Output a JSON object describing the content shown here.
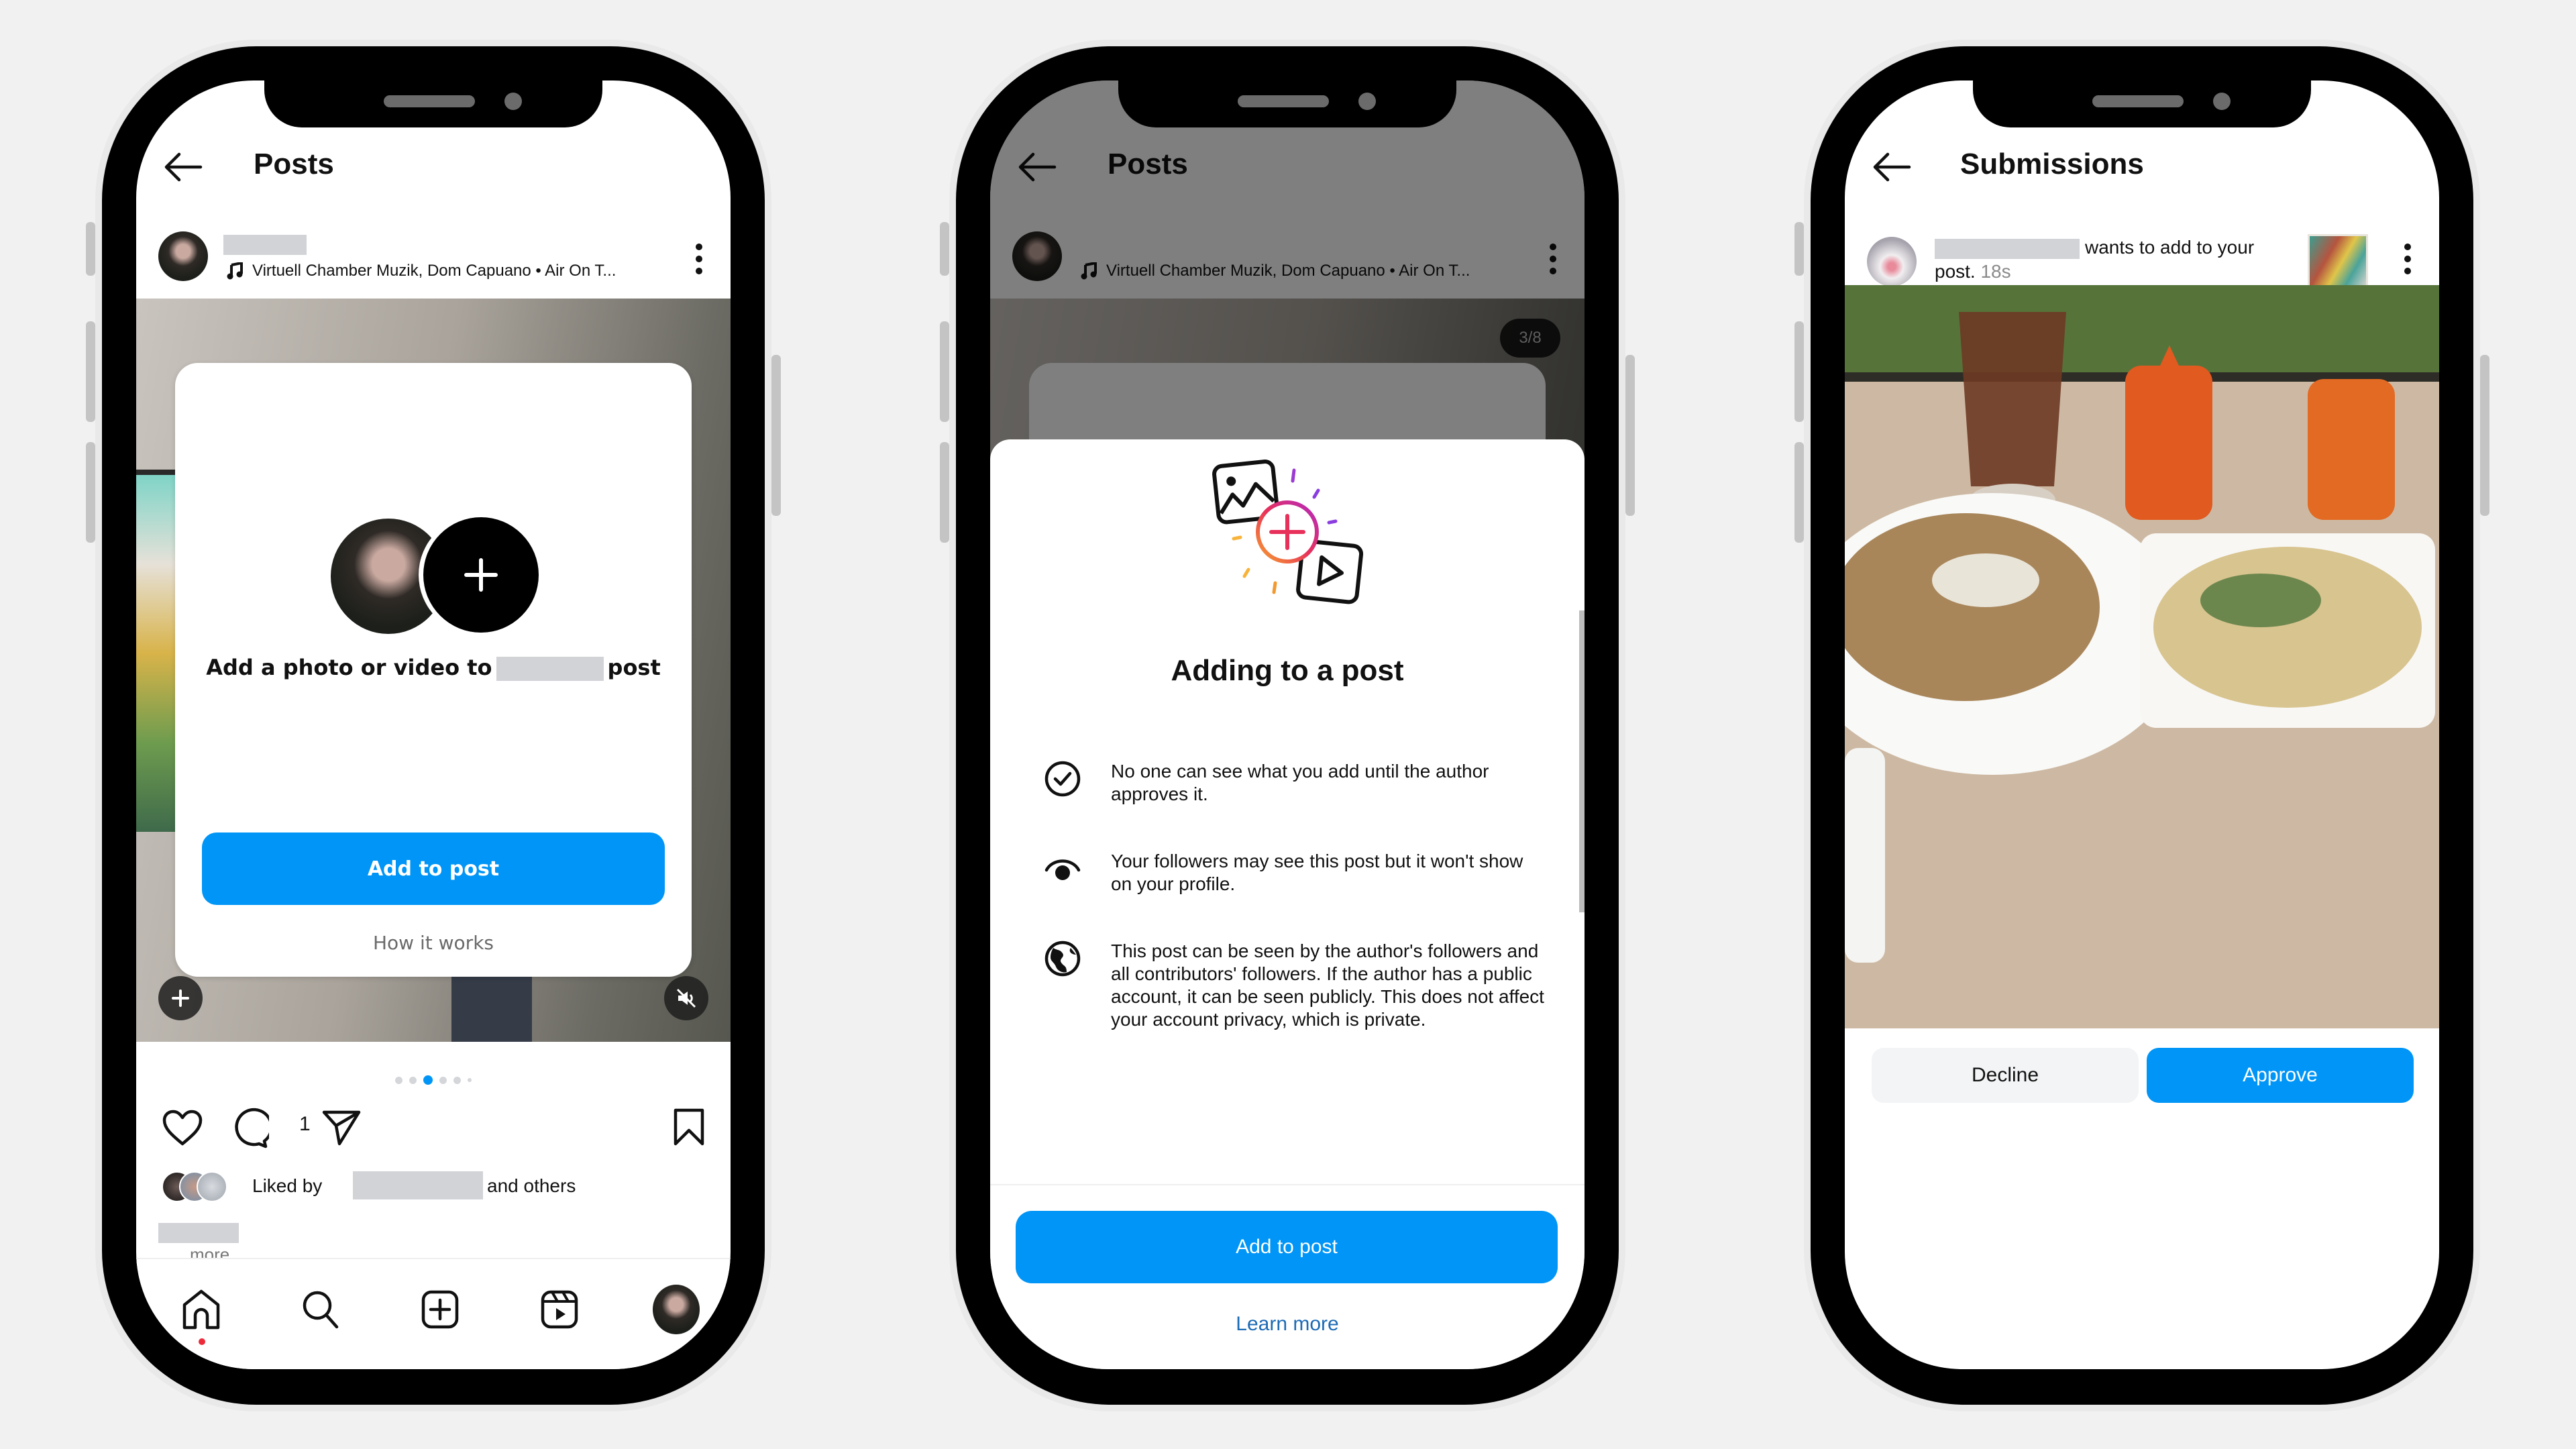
{
  "colors": {
    "primary_blue": "#0095f6",
    "link_blue": "#1c6bb5",
    "redaction_gray": "#d2d3d7",
    "notification_red": "#ed2a3a",
    "background": "#f1f1f1"
  },
  "phones": [
    {
      "header": {
        "title": "Posts",
        "back_icon": "arrow-left-icon"
      },
      "post": {
        "username": "[redacted]",
        "music_icon": "music-note-icon",
        "audio": "Virtuell Chamber Muzik, Dom Capuano • Air On T...",
        "more_icon": "kebab-vertical-icon"
      },
      "add_card": {
        "prompt_before": "Add a photo or video to",
        "prompt_after": "post",
        "primary_button": "Add to post",
        "secondary_link": "How it works"
      },
      "media_controls": {
        "add_icon": "plus-icon",
        "mute_icon": "speaker-muted-icon"
      },
      "carousel": {
        "total_dots": 6,
        "active_index": 2
      },
      "actions": {
        "like_icon": "heart-icon",
        "comment_icon": "comment-icon",
        "comment_count": "1",
        "share_icon": "send-icon",
        "save_icon": "bookmark-icon"
      },
      "likes": {
        "prefix": "Liked by",
        "suffix": "and others"
      },
      "caption": {
        "more": "more"
      },
      "bottom_nav": [
        "home-icon",
        "search-icon",
        "create-icon",
        "reels-icon",
        "profile-avatar"
      ]
    },
    {
      "header": {
        "title": "Posts"
      },
      "post": {
        "audio": "Virtuell Chamber Muzik, Dom Capuano • Air On T..."
      },
      "carousel_badge": "3/8",
      "sheet": {
        "title": "Adding to a post",
        "items": [
          {
            "icon": "check-circle-icon",
            "text": "No one can see what you add until the author approves it."
          },
          {
            "icon": "eye-icon",
            "text": "Your followers may see this post but it won't show on your profile."
          },
          {
            "icon": "globe-icon",
            "text": "This post can be seen by the author's followers and all contributors' followers. If the author has a public account, it can be seen publicly. This does not affect your account privacy, which is private."
          }
        ],
        "primary_button": "Add to post",
        "secondary_link": "Learn more"
      }
    },
    {
      "header": {
        "title": "Submissions"
      },
      "submission": {
        "text": "wants to add to your post.",
        "time": "18s"
      },
      "buttons": {
        "decline": "Decline",
        "approve": "Approve"
      }
    }
  ]
}
